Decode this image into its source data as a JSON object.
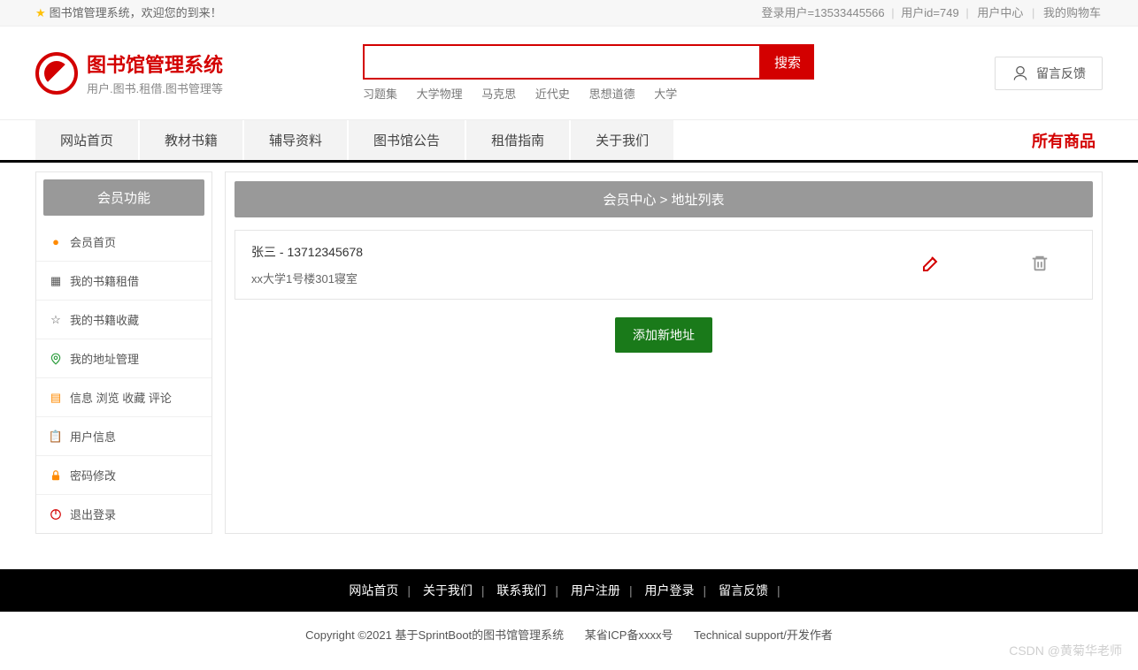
{
  "topbar": {
    "welcome": "图书馆管理系统，欢迎您的到来！",
    "login_user_label": "登录用户=13533445566",
    "user_id_label": "用户id=749",
    "user_center": "用户中心",
    "cart": "我的购物车"
  },
  "logo": {
    "title": "图书馆管理系统",
    "subtitle": "用户.图书.租借.图书管理等"
  },
  "search": {
    "placeholder": "",
    "value": "",
    "button": "搜索",
    "hotwords": [
      "习题集",
      "大学物理",
      "马克思",
      "近代史",
      "思想道德",
      "大学"
    ]
  },
  "feedback": {
    "label": "留言反馈"
  },
  "nav": {
    "items": [
      "网站首页",
      "教材书籍",
      "辅导资料",
      "图书馆公告",
      "租借指南",
      "关于我们"
    ],
    "right": "所有商品"
  },
  "sidebar": {
    "title": "会员功能",
    "items": [
      {
        "label": "会员首页",
        "icon": "home-icon",
        "color": "orange"
      },
      {
        "label": "我的书籍租借",
        "icon": "grid-icon",
        "color": ""
      },
      {
        "label": "我的书籍收藏",
        "icon": "star-icon",
        "color": ""
      },
      {
        "label": "我的地址管理",
        "icon": "location-icon",
        "color": "green"
      },
      {
        "label": "信息 浏览 收藏 评论",
        "icon": "doc-icon",
        "color": "orange"
      },
      {
        "label": "用户信息",
        "icon": "clipboard-icon",
        "color": "blue"
      },
      {
        "label": "密码修改",
        "icon": "lock-icon",
        "color": "orange"
      },
      {
        "label": "退出登录",
        "icon": "power-icon",
        "color": "red"
      }
    ]
  },
  "breadcrumb": {
    "full": "会员中心 > 地址列表"
  },
  "address": {
    "name_phone": "张三 - 13712345678",
    "detail": "xx大学1号楼301寝室"
  },
  "buttons": {
    "add_address": "添加新地址"
  },
  "footer": {
    "links": [
      "网站首页",
      "关于我们",
      "联系我们",
      "用户注册",
      "用户登录",
      "留言反馈"
    ],
    "copyright": "Copyright ©2021 基于SprintBoot的图书馆管理系统",
    "icp": "某省ICP备xxxx号",
    "tech": "Technical support/开发作者"
  },
  "watermark": "CSDN @黄菊华老师"
}
